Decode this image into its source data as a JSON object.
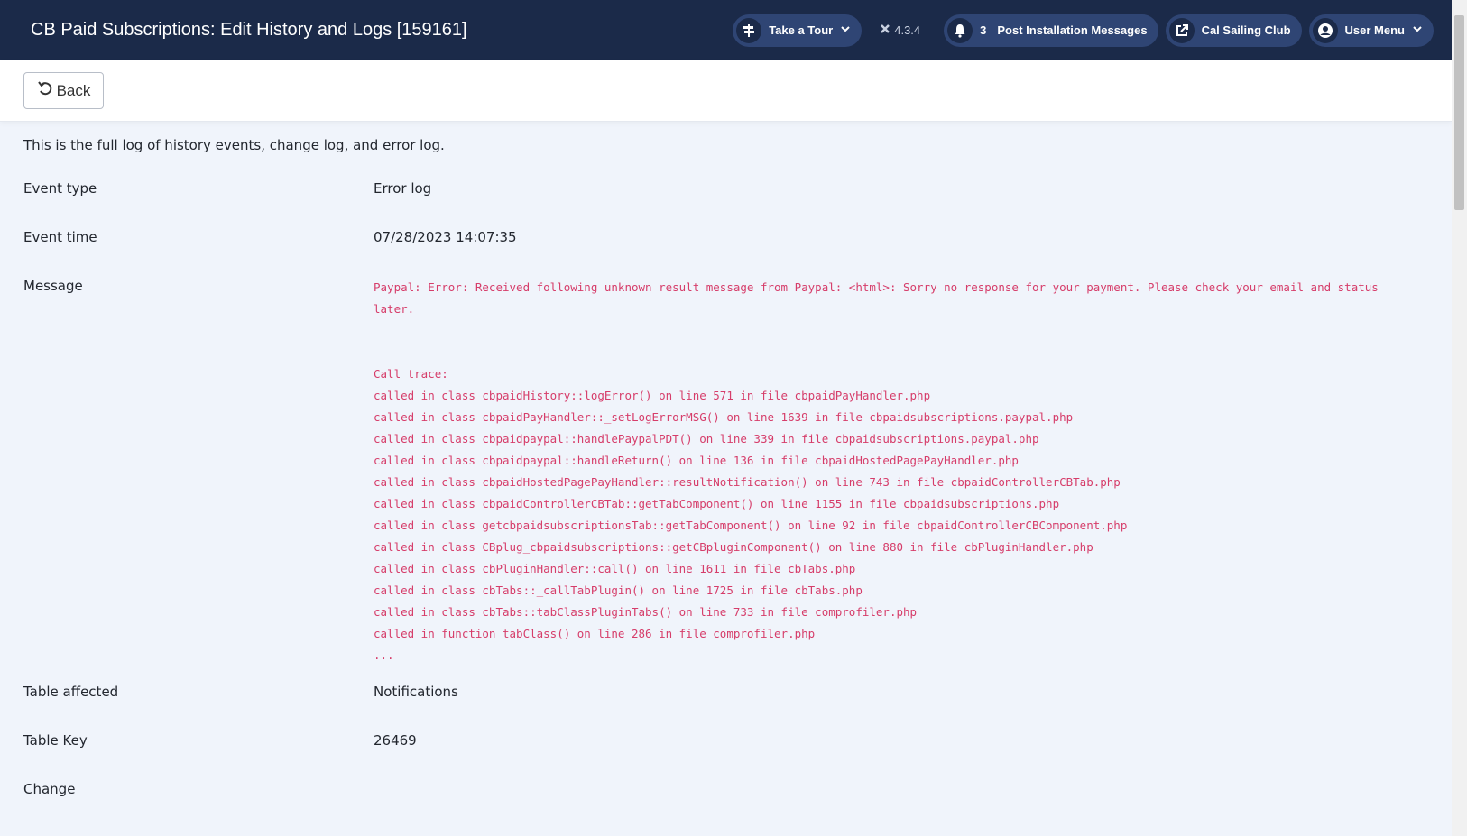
{
  "header": {
    "title": "CB Paid Subscriptions: Edit History and Logs [159161]",
    "tour_label": "Take a Tour",
    "version": "4.3.4",
    "notif_count": "3",
    "post_install_label": "Post Installation Messages",
    "site_label": "Cal Sailing Club",
    "user_menu_label": "User Menu"
  },
  "toolbar": {
    "back_label": "Back"
  },
  "intro": "This is the full log of history events, change log, and error log.",
  "fields": {
    "event_type_label": "Event type",
    "event_type_value": "Error log",
    "event_time_label": "Event time",
    "event_time_value": "07/28/2023 14:07:35",
    "message_label": "Message",
    "message_line1": "Paypal: Error: Received following unknown result message from Paypal: <html>: Sorry no response for your payment. Please check your email and status",
    "message_line2": "later.",
    "call_trace_header": "Call trace:",
    "call_trace": [
      "called in class cbpaidHistory::logError() on line 571 in file cbpaidPayHandler.php",
      "called in class cbpaidPayHandler::_setLogErrorMSG() on line 1639 in file cbpaidsubscriptions.paypal.php",
      "called in class cbpaidpaypal::handlePaypalPDT() on line 339 in file cbpaidsubscriptions.paypal.php",
      "called in class cbpaidpaypal::handleReturn() on line 136 in file cbpaidHostedPagePayHandler.php",
      "called in class cbpaidHostedPagePayHandler::resultNotification() on line 743 in file cbpaidControllerCBTab.php",
      "called in class cbpaidControllerCBTab::getTabComponent() on line 1155 in file cbpaidsubscriptions.php",
      "called in class getcbpaidsubscriptionsTab::getTabComponent() on line 92 in file cbpaidControllerCBComponent.php",
      "called in class CBplug_cbpaidsubscriptions::getCBpluginComponent() on line 880 in file cbPluginHandler.php",
      "called in class cbPluginHandler::call() on line 1611 in file cbTabs.php",
      "called in class cbTabs::_callTabPlugin() on line 1725 in file cbTabs.php",
      "called in class cbTabs::tabClassPluginTabs() on line 733 in file comprofiler.php",
      "called in function tabClass() on line 286 in file comprofiler.php"
    ],
    "call_trace_ellipsis": "...",
    "table_affected_label": "Table affected",
    "table_affected_value": "Notifications",
    "table_key_label": "Table Key",
    "table_key_value": "26469",
    "change_label": "Change"
  }
}
